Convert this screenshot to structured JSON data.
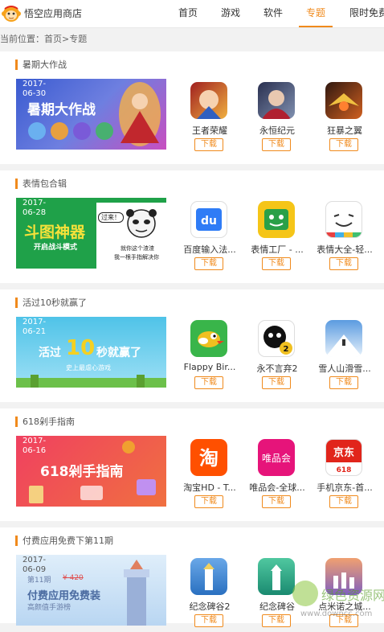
{
  "header": {
    "brand": "悟空应用商店",
    "nav": [
      "首页",
      "游戏",
      "软件",
      "专题",
      "限时免费"
    ],
    "active_index": 3,
    "accent": "#f08a1c"
  },
  "breadcrumb": {
    "prefix": "当前位置：",
    "home": "首页",
    "sep": ">",
    "current": "专题"
  },
  "sections": [
    {
      "title": "暑期大作战",
      "banner": {
        "date1": "2017-",
        "date2": "06-30",
        "text": "暑期大作战"
      },
      "apps": [
        {
          "name": "王者荣耀",
          "icon": "honor-of-kings-icon",
          "download": "下载"
        },
        {
          "name": "永恒纪元",
          "icon": "eternal-era-icon",
          "download": "下载"
        },
        {
          "name": "狂暴之翼",
          "icon": "wings-of-fury-icon",
          "download": "下载"
        }
      ]
    },
    {
      "title": "表情包合辑",
      "banner": {
        "date1": "2017-",
        "date2": "06-28",
        "text": "斗图神器",
        "sub": "开启战斗模式",
        "bubble": "过来！",
        "line1": "就你这个渣渣",
        "line2": "我一根手指解决你"
      },
      "apps": [
        {
          "name": "百度输入法...",
          "icon": "baidu-input-icon",
          "download": "下载"
        },
        {
          "name": "表情工厂 - ...",
          "icon": "emoji-factory-icon",
          "download": "下载"
        },
        {
          "name": "表情大全-轻...",
          "icon": "emoji-collection-icon",
          "download": "下载"
        }
      ]
    },
    {
      "title": "活过10秒就赢了",
      "banner": {
        "date1": "2017-",
        "date2": "06-21",
        "text1": "活过",
        "num": "10",
        "text2": "秒就赢了",
        "sub": "史上最虐心游戏"
      },
      "apps": [
        {
          "name": "Flappy Bir...",
          "icon": "flappy-bird-icon",
          "download": "下载"
        },
        {
          "name": "永不言弃2",
          "icon": "never-give-up-icon",
          "download": "下载"
        },
        {
          "name": "雪人山滑雪...",
          "icon": "skiing-yeti-icon",
          "download": "下载"
        }
      ]
    },
    {
      "title": "618剁手指南",
      "banner": {
        "date1": "2017-",
        "date2": "06-16",
        "text": "618剁手指南"
      },
      "apps": [
        {
          "name": "淘宝HD - T...",
          "icon": "taobao-icon",
          "download": "下载"
        },
        {
          "name": "唯品会-全球...",
          "icon": "vip-icon",
          "download": "下载"
        },
        {
          "name": "手机京东-首...",
          "icon": "jd-icon",
          "download": "下载"
        }
      ]
    },
    {
      "title": "付费应用免费下第11期",
      "banner": {
        "date1": "2017-",
        "date2": "06-09",
        "issue": "第11期",
        "price": "¥ 420",
        "text": "付费应用免费装",
        "sub": "高颜值手游榜"
      },
      "apps": [
        {
          "name": "纪念碑谷2",
          "icon": "monument-valley-2-icon",
          "download": "下载"
        },
        {
          "name": "纪念碑谷",
          "icon": "monument-valley-icon",
          "download": "下载"
        },
        {
          "name": "点米诺之城...",
          "icon": "domino-city-icon",
          "download": "下载"
        }
      ]
    }
  ],
  "watermark": {
    "text": "绿色资源网",
    "url": "www.downcc.com"
  }
}
